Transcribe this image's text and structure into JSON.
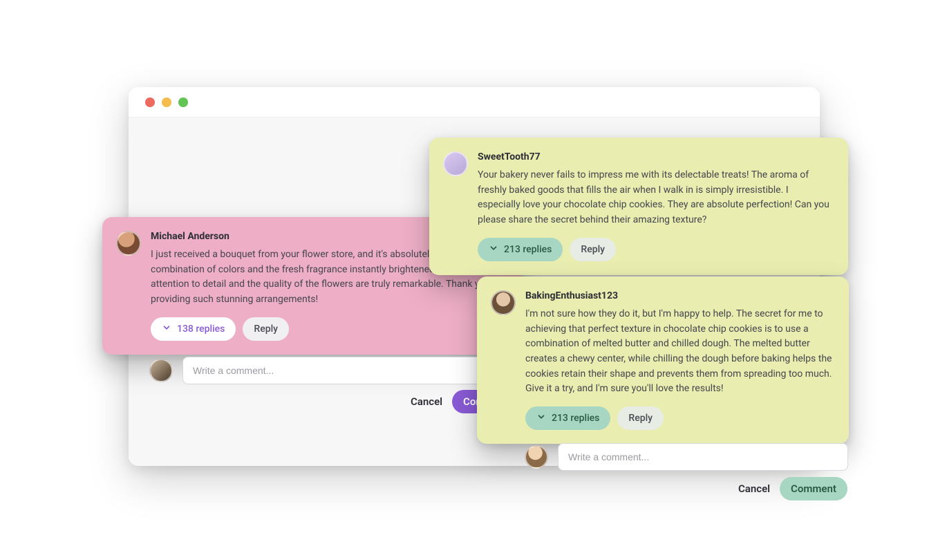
{
  "window": {
    "dot_red": "#ee6a5f",
    "dot_amber": "#f5bd4f",
    "dot_green": "#61c454"
  },
  "comments": {
    "pink": {
      "author": "Michael Anderson",
      "body": "I just received a bouquet from your flower store, and it's absolutely beautiful! The combination of colors and the fresh fragrance instantly brightened up my day. Your attention to detail and the quality of the flowers are truly remarkable. Thank you for providing such stunning arrangements!",
      "replies_label": "138 replies",
      "reply_label": "Reply"
    },
    "yellow1": {
      "author": "SweetTooth77",
      "body": "Your bakery never fails to impress me with its delectable treats! The aroma of freshly baked goods that fills the air when I walk in is simply irresistible. I especially love your chocolate chip cookies. They are absolute perfection! Can you please share the secret behind their amazing texture?",
      "replies_label": "213 replies",
      "reply_label": "Reply"
    },
    "yellow2": {
      "author": "BakingEnthusiast123",
      "body": "I'm not sure how they do it, but I'm happy to help. The secret for me to achieving that perfect texture in chocolate chip cookies is to use a combination of melted butter and chilled dough. The melted butter creates a chewy center, while chilling the dough before baking helps the cookies retain their shape and prevents them from spreading too much. Give it a try, and I'm sure you'll love the results!",
      "replies_label": "213 replies",
      "reply_label": "Reply"
    }
  },
  "composer": {
    "placeholder": "Write a comment...",
    "cancel": "Cancel",
    "submit": "Comment"
  }
}
